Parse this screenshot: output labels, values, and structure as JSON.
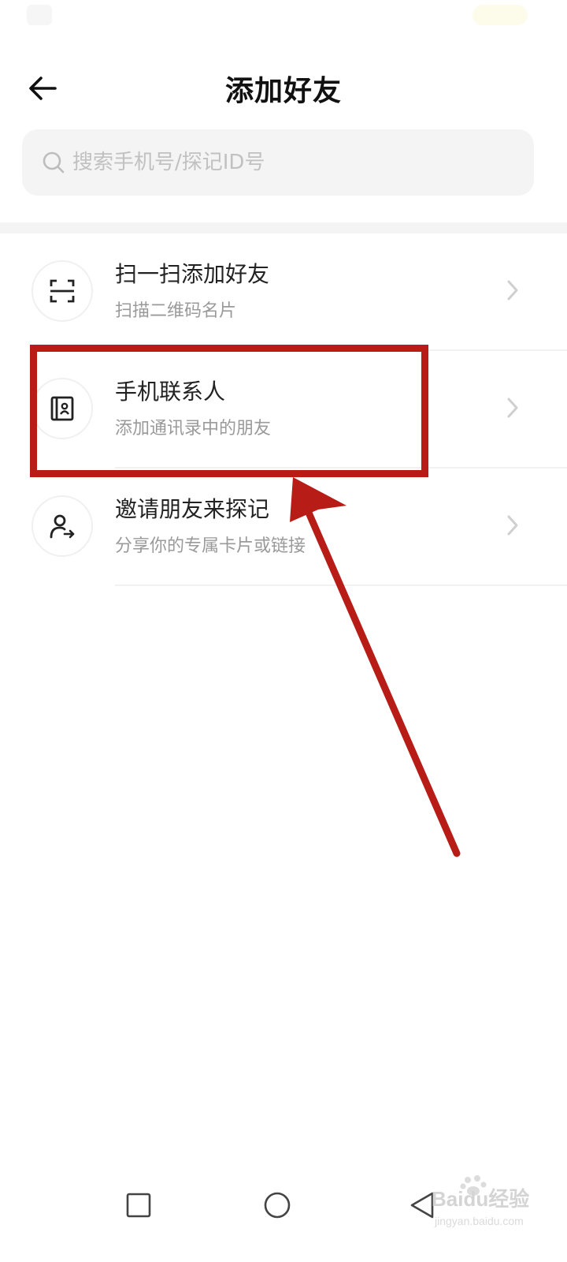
{
  "header": {
    "title": "添加好友",
    "back_icon": "arrow-left-icon"
  },
  "search": {
    "placeholder": "搜索手机号/探记ID号",
    "icon": "search-icon"
  },
  "list": [
    {
      "icon": "scan-icon",
      "title": "扫一扫添加好友",
      "subtitle": "扫描二维码名片"
    },
    {
      "icon": "contact-book-icon",
      "title": "手机联系人",
      "subtitle": "添加通讯录中的朋友"
    },
    {
      "icon": "user-share-icon",
      "title": "邀请朋友来探记",
      "subtitle": "分享你的专属卡片或链接"
    }
  ],
  "annotation": {
    "color": "#b71c17"
  },
  "nav": {
    "icons": [
      "square-icon",
      "circle-icon",
      "triangle-back-icon"
    ]
  },
  "watermark": {
    "text": "Baidu经验",
    "sub": "jingyan.baidu.com"
  },
  "colors": {
    "background": "#ffffff",
    "search_bg": "#f4f4f4",
    "subtitle": "#9a9a9a",
    "highlight": "#b71c17"
  }
}
